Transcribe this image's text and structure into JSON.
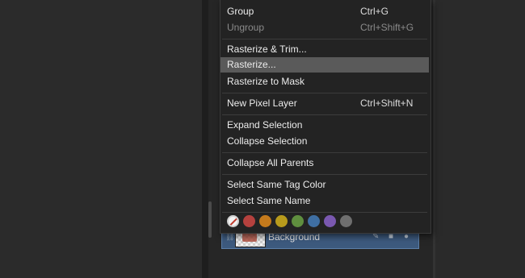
{
  "context_menu": {
    "items": [
      {
        "label": "Group",
        "shortcut": "Ctrl+G",
        "disabled": false
      },
      {
        "label": "Ungroup",
        "shortcut": "Ctrl+Shift+G",
        "disabled": true
      },
      {
        "label": "Rasterize & Trim...",
        "shortcut": "",
        "disabled": false
      },
      {
        "label": "Rasterize...",
        "shortcut": "",
        "disabled": false,
        "highlighted": true
      },
      {
        "label": "Rasterize to Mask",
        "shortcut": "",
        "disabled": false
      },
      {
        "label": "New Pixel Layer",
        "shortcut": "Ctrl+Shift+N",
        "disabled": false
      },
      {
        "label": "Expand Selection",
        "shortcut": "",
        "disabled": false
      },
      {
        "label": "Collapse Selection",
        "shortcut": "",
        "disabled": false
      },
      {
        "label": "Collapse All Parents",
        "shortcut": "",
        "disabled": false
      },
      {
        "label": "Select Same Tag Color",
        "shortcut": "",
        "disabled": false
      },
      {
        "label": "Select Same Name",
        "shortcut": "",
        "disabled": false
      }
    ],
    "tag_colors": [
      {
        "name": "none",
        "color": "#f3f3f3"
      },
      {
        "name": "red",
        "color": "#b5413e"
      },
      {
        "name": "orange",
        "color": "#c47a1c"
      },
      {
        "name": "yellow",
        "color": "#b89b1c"
      },
      {
        "name": "green",
        "color": "#5f8f3f"
      },
      {
        "name": "blue",
        "color": "#3f6fa3"
      },
      {
        "name": "purple",
        "color": "#7a58b0"
      },
      {
        "name": "gray",
        "color": "#6e6e6e"
      }
    ]
  },
  "layers_panel": {
    "selected_layer": {
      "name": "Background"
    }
  }
}
